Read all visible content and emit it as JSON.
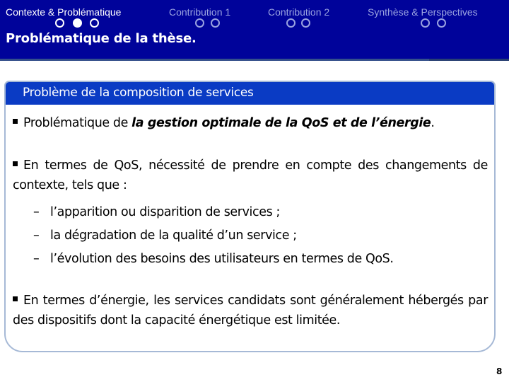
{
  "header": {
    "sections": [
      {
        "label": "Contexte & Problématique",
        "dots": 3,
        "current_dot": 1,
        "active": true
      },
      {
        "label": "Contribution 1",
        "dots": 2,
        "current_dot": null,
        "active": false
      },
      {
        "label": "Contribution 2",
        "dots": 2,
        "current_dot": null,
        "active": false
      },
      {
        "label": "Synthèse & Perspectives",
        "dots": 2,
        "current_dot": null,
        "active": false
      }
    ],
    "slide_title": "Problématique de la thèse."
  },
  "box": {
    "title": "Problème de la composition de services",
    "p1": {
      "prefix": "Problématique de ",
      "emphasis": "la gestion optimale de la QoS et de l’énergie",
      "suffix": "."
    },
    "p2": {
      "text": "En termes de QoS, nécessité de prendre en compte des changements de contexte, tels que :",
      "subitems": [
        "l’apparition ou disparition de services ;",
        "la dégradation de la qualité d’un service ;",
        "l’évolution des besoins des utilisateurs en termes de QoS."
      ],
      "dash": "–"
    },
    "p3": {
      "text": "En termes d’énergie, les services candidats sont généralement hébergés par des dispositifs dont la capacité énergétique est limitée."
    }
  },
  "page_number": "8",
  "colors": {
    "header_bg": "#00039a",
    "box_header_bg": "#0a3bc4",
    "box_border": "#a6b9d6",
    "inactive_nav": "#9aa3e0"
  }
}
